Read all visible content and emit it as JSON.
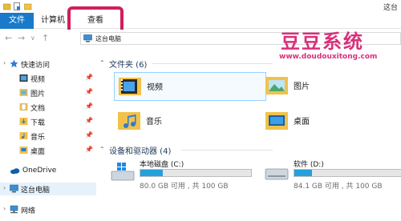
{
  "title_bar": {
    "title": "这台"
  },
  "ribbon": {
    "tabs": {
      "file": "文件",
      "computer": "计算机",
      "view": "查看"
    },
    "colors": {
      "file_tab": "#1979ca",
      "highlight": "#cf1f5e"
    }
  },
  "address": {
    "path": "这台电脑",
    "back": "←",
    "forward": "→",
    "dropdown": "∨",
    "up": "↑"
  },
  "watermark": {
    "logo": "豆豆系统",
    "url": "www.doudouxitong.com"
  },
  "sidebar": {
    "quick_access": "快速访问",
    "items": [
      {
        "label": "视频",
        "icon": "video-folder-icon"
      },
      {
        "label": "图片",
        "icon": "pictures-folder-icon"
      },
      {
        "label": "文档",
        "icon": "documents-folder-icon"
      },
      {
        "label": "下载",
        "icon": "downloads-folder-icon"
      },
      {
        "label": "音乐",
        "icon": "music-folder-icon"
      },
      {
        "label": "桌面",
        "icon": "desktop-folder-icon"
      }
    ],
    "onedrive": "OneDrive",
    "this_pc": "这台电脑",
    "network": "网络"
  },
  "main": {
    "folders_header": "文件夹 (6)",
    "folders": [
      {
        "name": "视频",
        "icon": "video-folder-icon"
      },
      {
        "name": "图片",
        "icon": "pictures-folder-icon"
      },
      {
        "name": "音乐",
        "icon": "music-folder-icon"
      },
      {
        "name": "桌面",
        "icon": "desktop-folder-icon"
      }
    ],
    "devices_header": "设备和驱动器 (4)",
    "drives": [
      {
        "name": "本地磁盘 (C:)",
        "space": "80.0 GB 可用 , 共 100 GB",
        "used_fraction": 0.2
      },
      {
        "name": "软件 (D:)",
        "space": "84.1 GB 可用 , 共 100 GB",
        "used_fraction": 0.16
      }
    ]
  }
}
